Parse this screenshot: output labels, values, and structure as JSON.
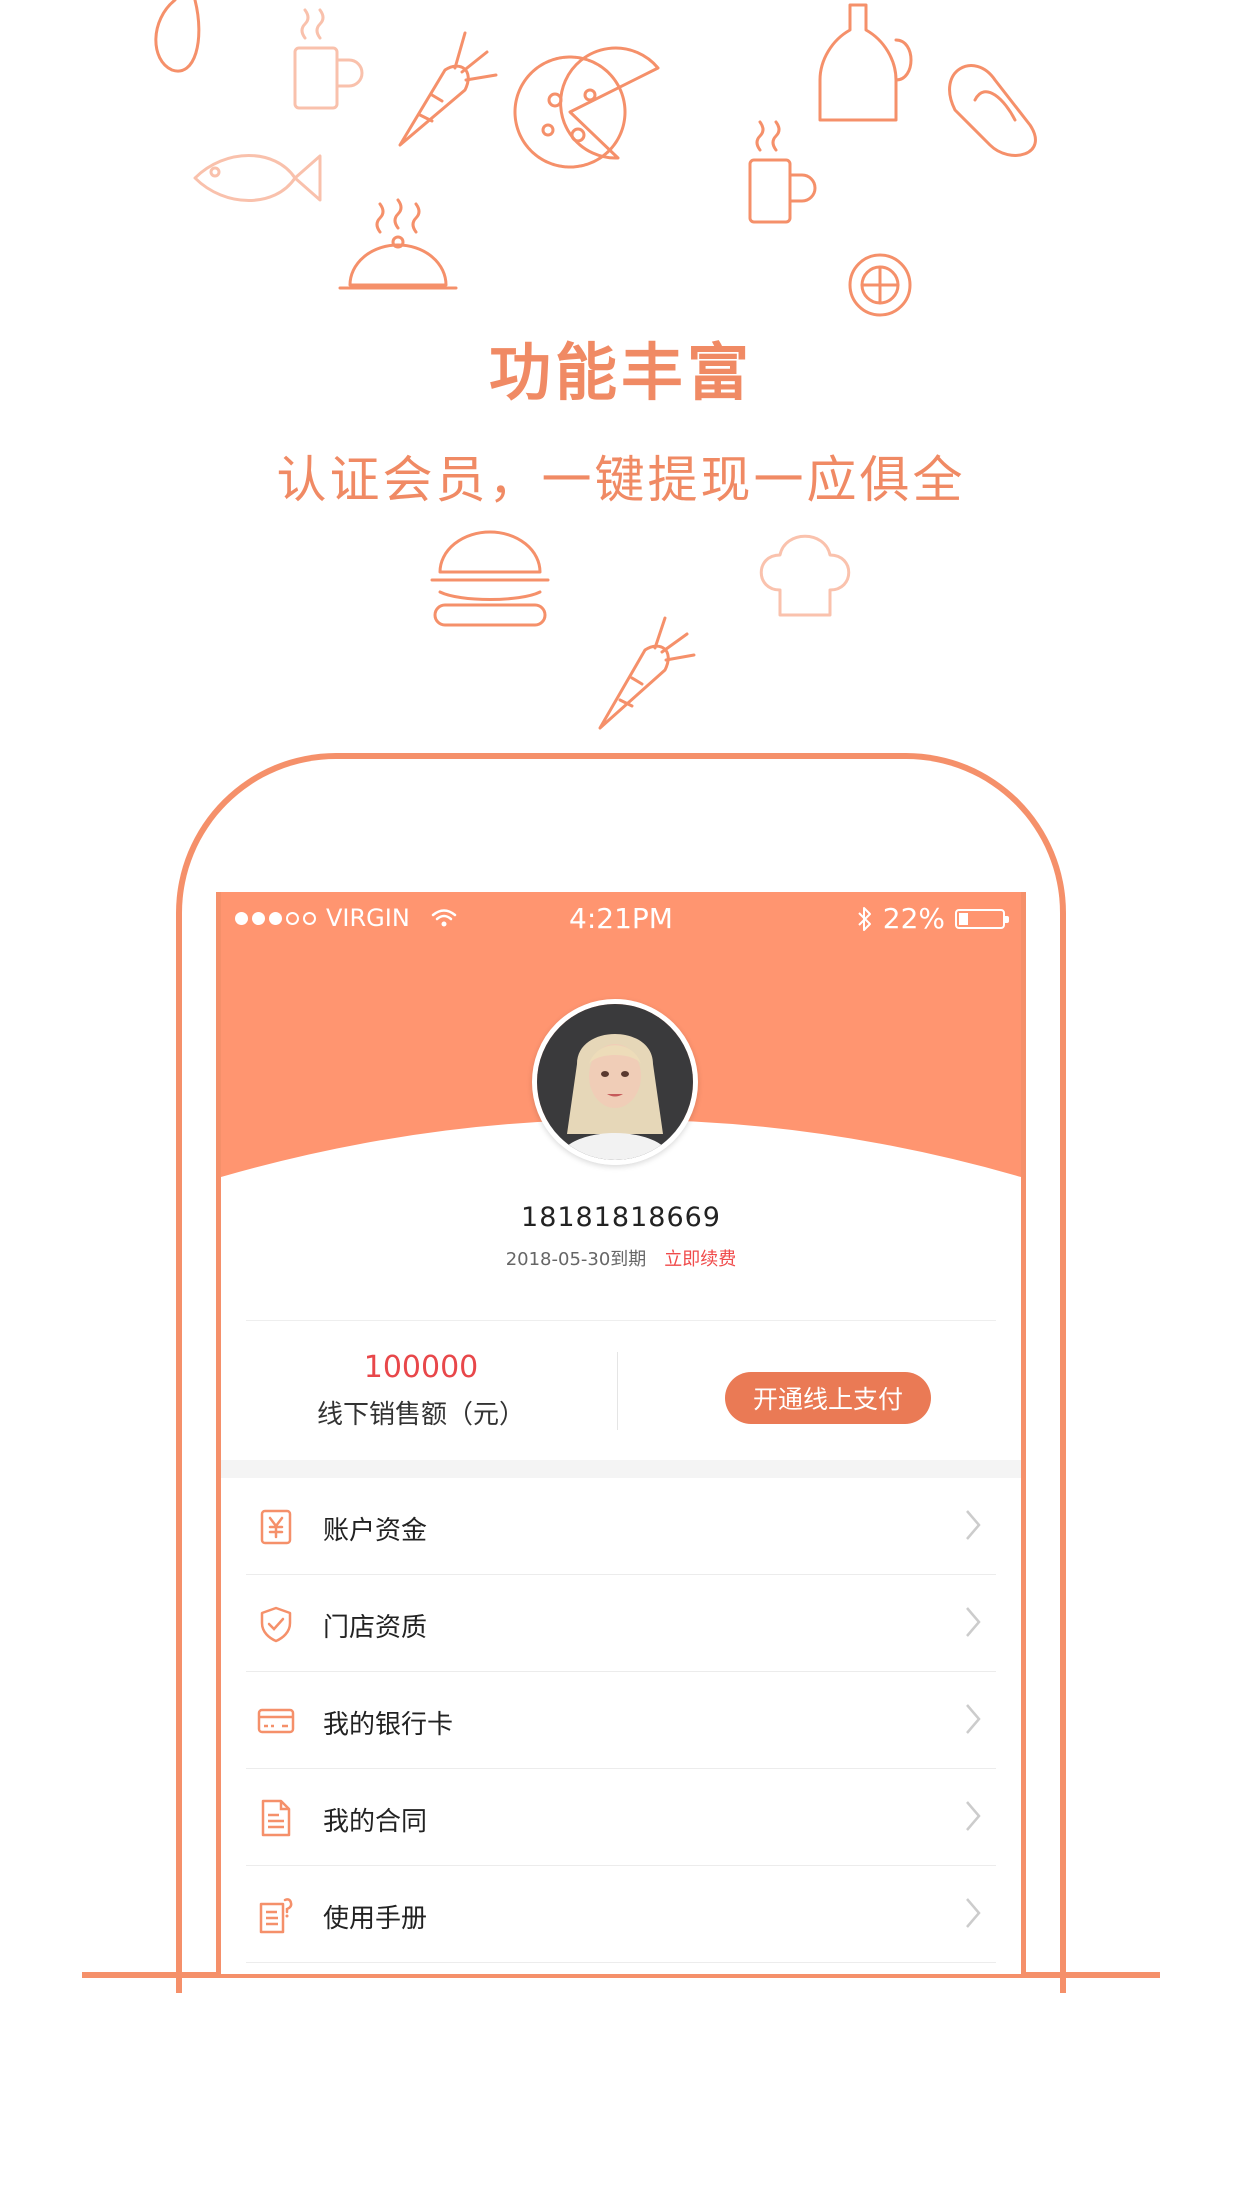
{
  "hero": {
    "title": "功能丰富",
    "subtitle": "认证会员，一键提现一应俱全"
  },
  "status_bar": {
    "carrier": "VIRGIN",
    "time": "4:21PM",
    "battery": "22%",
    "battery_level": 0.22
  },
  "profile": {
    "phone": "18181818669",
    "expiry": "2018-05-30到期",
    "renew_label": "立即续费"
  },
  "sales": {
    "value": "100000",
    "label": "线下销售额（元）",
    "pay_button": "开通线上支付"
  },
  "menu": {
    "items": [
      {
        "label": "账户资金",
        "icon": "yuan-icon"
      },
      {
        "label": "门店资质",
        "icon": "shield-check-icon"
      },
      {
        "label": "我的银行卡",
        "icon": "bank-card-icon"
      },
      {
        "label": "我的合同",
        "icon": "document-icon"
      },
      {
        "label": "使用手册",
        "icon": "manual-icon"
      }
    ]
  },
  "colors": {
    "accent": "#f5906a",
    "header": "#ff9570",
    "button": "#ea7a55",
    "highlight_red": "#e8474a"
  }
}
